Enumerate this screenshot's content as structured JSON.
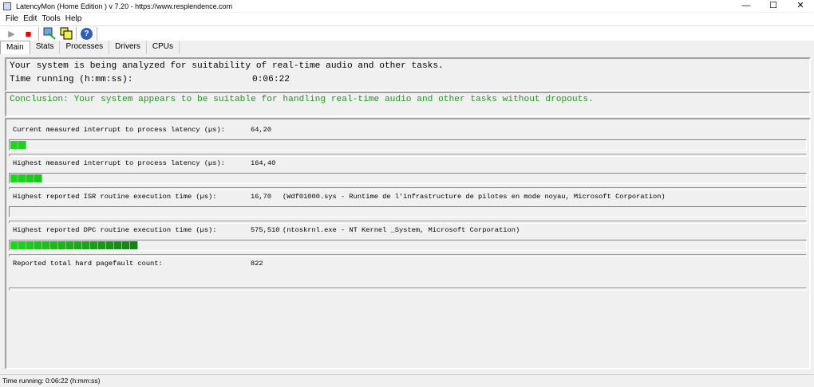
{
  "window": {
    "title": "LatencyMon  (Home Edition )  v 7.20 - https://www.resplendence.com",
    "minimize": "—",
    "maximize": "☐",
    "close": "✕"
  },
  "menu": [
    "File",
    "Edit",
    "Tools",
    "Help"
  ],
  "toolbar": {
    "play": "▶",
    "stop": "■",
    "help": "?"
  },
  "tabs": [
    "Main",
    "Stats",
    "Processes",
    "Drivers",
    "CPUs"
  ],
  "summary": {
    "line1": "Your system is being analyzed for suitability of real-time audio and other tasks.",
    "time_label": "Time running (h:mm:ss):",
    "time_value": "0:06:22"
  },
  "conclusion": "Conclusion: Your system appears to be suitable for handling real-time audio and other tasks without dropouts.",
  "colors": {
    "conclusion": "#1a9a1a",
    "bar": "#22dd22"
  },
  "metrics": [
    {
      "label": "Current measured interrupt to process latency (µs):",
      "value": "64,20",
      "extra": "",
      "bar_percent": 2
    },
    {
      "label": "Highest measured interrupt to process latency (µs):",
      "value": "164,40",
      "extra": "",
      "bar_percent": 4
    },
    {
      "label": "Highest reported ISR routine execution time (µs):",
      "value": "16,70",
      "extra": "(Wdf01000.sys - Runtime de l'infrastructure de pilotes en mode noyau, Microsoft Corporation)",
      "bar_percent": 0
    },
    {
      "label": "Highest reported DPC routine execution time (µs):",
      "value": "575,510",
      "extra": "(ntoskrnl.exe - NT Kernel _System, Microsoft Corporation)",
      "bar_percent": 16
    },
    {
      "label": "Reported total hard pagefault count:",
      "value": "822",
      "extra": ""
    }
  ],
  "status": "Time running: 0:06:22  (h:mm:ss)"
}
